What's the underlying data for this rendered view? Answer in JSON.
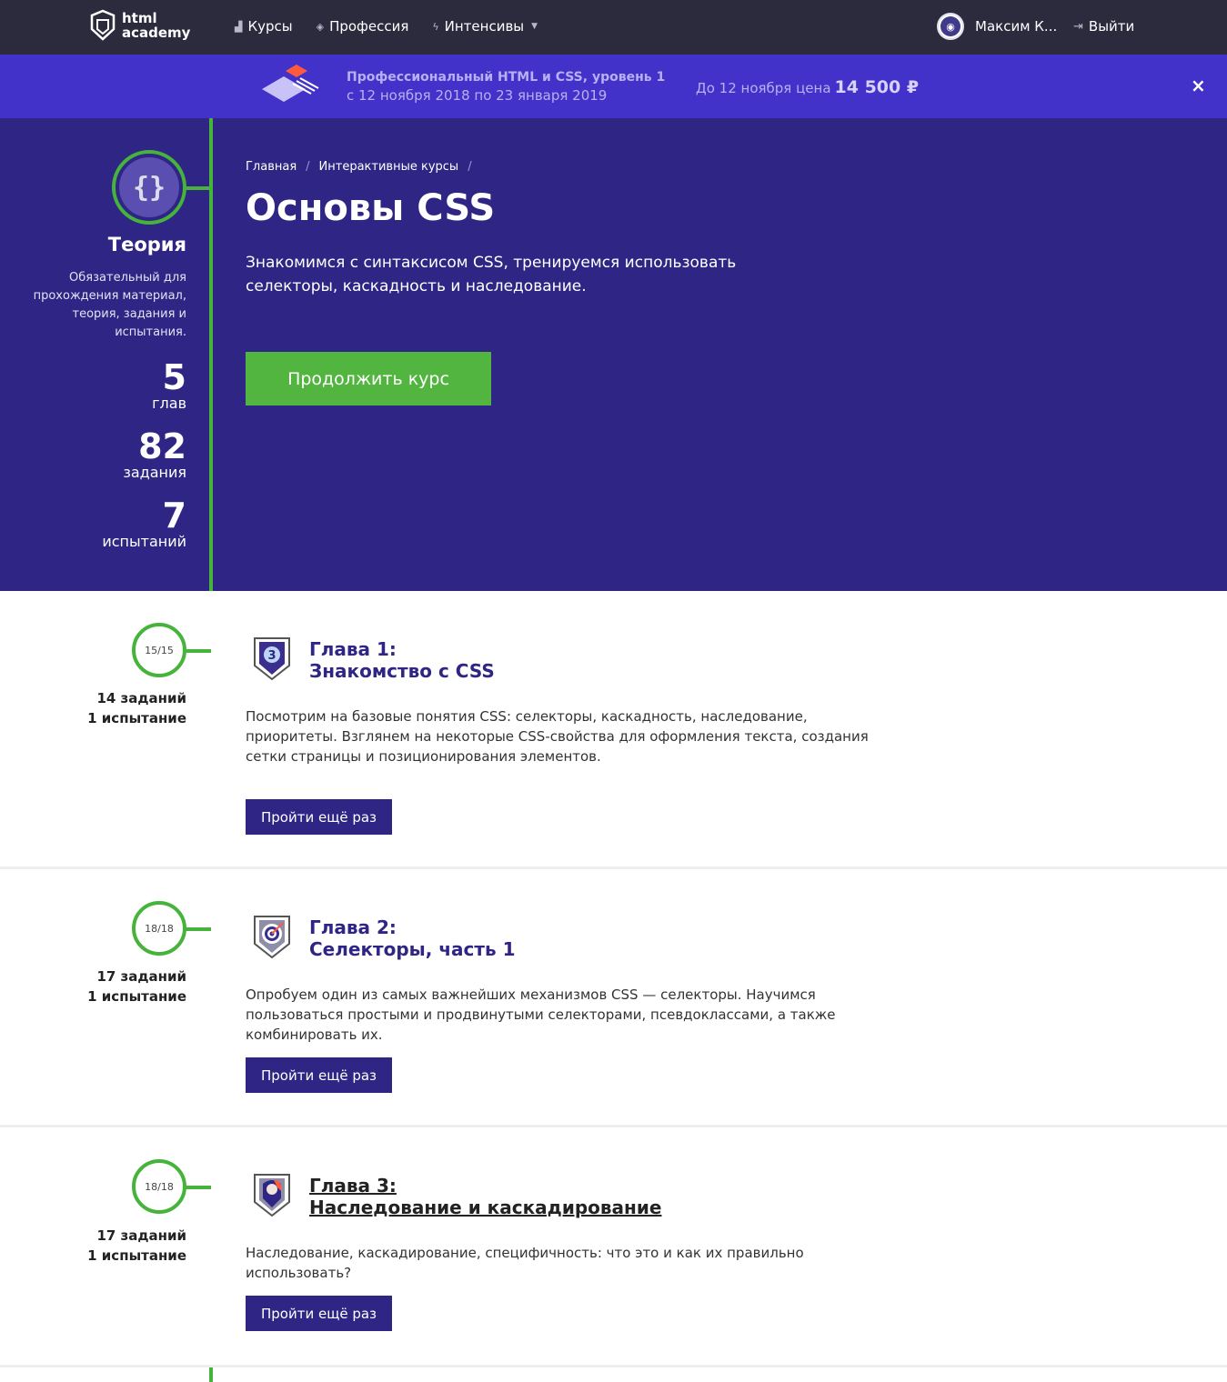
{
  "header": {
    "logo_line1": "html",
    "logo_line2": "academy",
    "nav": [
      {
        "label": "Курсы",
        "icon": "bars-icon"
      },
      {
        "label": "Профессия",
        "icon": "cap-icon"
      },
      {
        "label": "Интенсивы",
        "icon": "bolt-icon"
      }
    ],
    "user_name": "Максим К...",
    "logout_label": "Выйти"
  },
  "promo": {
    "title": "Профессиональный HTML и CSS, уровень 1",
    "dates": "с 12 ноября 2018 по 23 января 2019",
    "price_prefix": "До 12 ноября цена",
    "price": "14 500 ₽",
    "close": "×"
  },
  "sidebar": {
    "title": "Теория",
    "desc": "Обязательный для прохождения материал, теория, задания и испытания.",
    "stats": [
      {
        "num": "5",
        "label": "глав"
      },
      {
        "num": "82",
        "label": "задания"
      },
      {
        "num": "7",
        "label": "испытаний"
      }
    ]
  },
  "hero": {
    "breadcrumbs": [
      "Главная",
      "Интерактивные курсы"
    ],
    "sep": "/",
    "title": "Основы CSS",
    "desc": "Знакомимся с синтаксисом CSS, тренируемся использовать селекторы, каскадность и наследование.",
    "button": "Продолжить курс"
  },
  "chapters": [
    {
      "progress": "15/15",
      "tasks": "14 заданий",
      "trials": "1 испытание",
      "title_line1": "Глава 1:",
      "title_line2": "Знакомство с CSS",
      "desc": "Посмотрим на базовые понятия CSS: селекторы, каскадность, наследование, приоритеты. Взглянем на некоторые CSS-свойства для оформления текста, создания сетки страницы и позиционирования элементов.",
      "button": "Пройти ещё раз"
    },
    {
      "progress": "18/18",
      "tasks": "17 заданий",
      "trials": "1 испытание",
      "title_line1": "Глава 2:",
      "title_line2": "Селекторы, часть 1",
      "desc": "Опробуем один из самых важнейших механизмов CSS — селекторы. Научимся пользоваться простыми и продвинутыми селекторами, псевдоклассами, а также комбинировать их.",
      "button": "Пройти ещё раз"
    },
    {
      "progress": "18/18",
      "tasks": "17 заданий",
      "trials": "1 испытание",
      "title_line1": "Глава 3:",
      "title_line2": "Наследование и каскадирование",
      "desc": "Наследование, каскадирование, специфичность: что это и как их правильно использовать?",
      "button": "Пройти ещё раз"
    }
  ]
}
